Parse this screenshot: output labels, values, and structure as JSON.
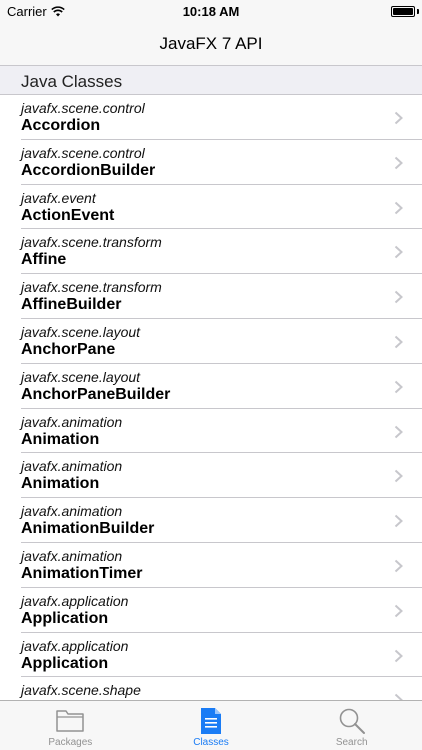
{
  "status_bar": {
    "carrier": "Carrier",
    "time": "10:18 AM"
  },
  "nav": {
    "title": "JavaFX 7 API"
  },
  "section": {
    "header": "Java Classes"
  },
  "rows": [
    {
      "package": "javafx.scene.control",
      "name": "Accordion"
    },
    {
      "package": "javafx.scene.control",
      "name": "AccordionBuilder"
    },
    {
      "package": "javafx.event",
      "name": "ActionEvent"
    },
    {
      "package": "javafx.scene.transform",
      "name": "Affine"
    },
    {
      "package": "javafx.scene.transform",
      "name": "AffineBuilder"
    },
    {
      "package": "javafx.scene.layout",
      "name": "AnchorPane"
    },
    {
      "package": "javafx.scene.layout",
      "name": "AnchorPaneBuilder"
    },
    {
      "package": "javafx.animation",
      "name": "Animation"
    },
    {
      "package": "javafx.animation",
      "name": "Animation"
    },
    {
      "package": "javafx.animation",
      "name": "AnimationBuilder"
    },
    {
      "package": "javafx.animation",
      "name": "AnimationTimer"
    },
    {
      "package": "javafx.application",
      "name": "Application"
    },
    {
      "package": "javafx.application",
      "name": "Application"
    },
    {
      "package": "javafx.scene.shape",
      "name": ""
    }
  ],
  "tabs": [
    {
      "label": "Packages",
      "icon": "folder-icon",
      "active": false
    },
    {
      "label": "Classes",
      "icon": "document-icon",
      "active": true
    },
    {
      "label": "Search",
      "icon": "magnifier-icon",
      "active": false
    }
  ],
  "colors": {
    "accent": "#1a7cf5",
    "inactive": "#929292"
  }
}
